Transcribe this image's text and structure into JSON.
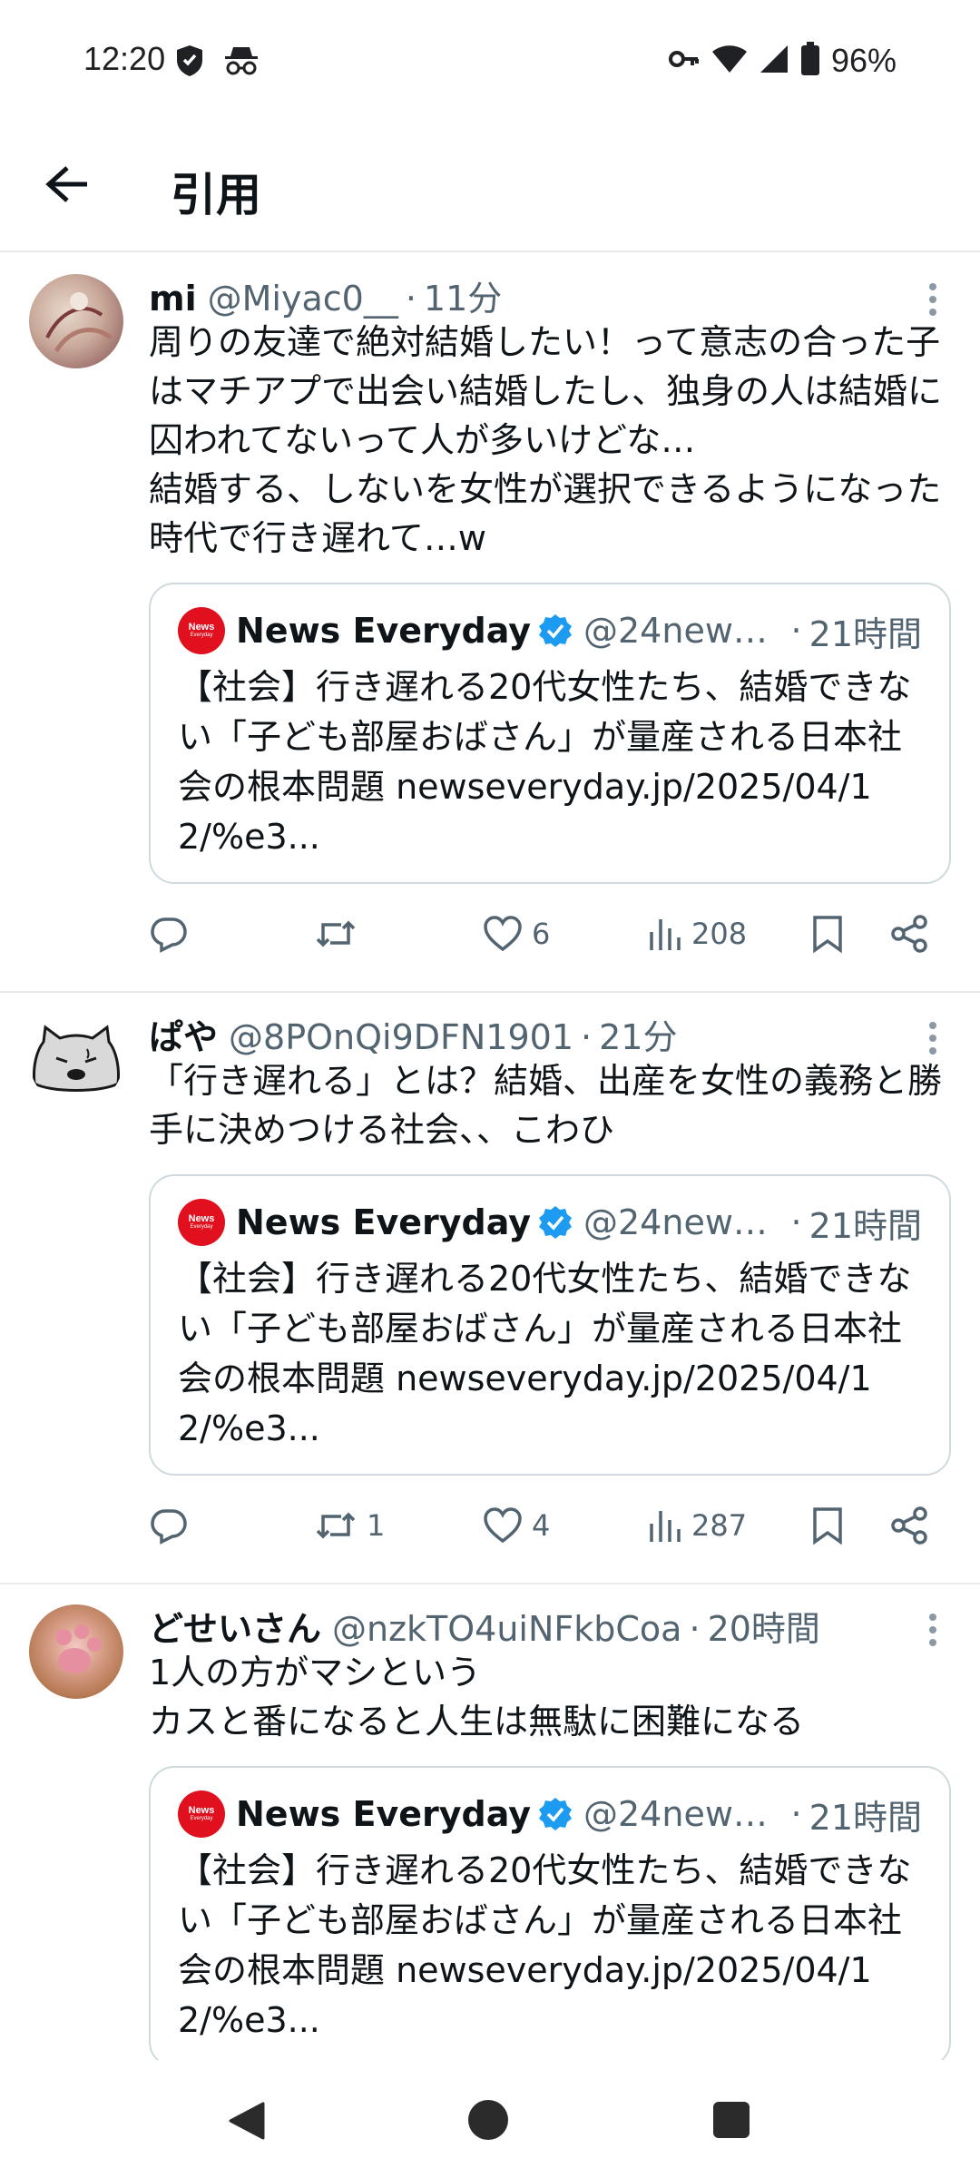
{
  "status_bar": {
    "time": "12:20",
    "battery": "96%",
    "left_icons": [
      "shield-icon",
      "incognito-icon"
    ],
    "right_icons": [
      "key-icon",
      "wifi-icon",
      "signal-icon",
      "battery-icon"
    ]
  },
  "header": {
    "title": "引用",
    "back_icon": "arrow-left-icon"
  },
  "tweets": [
    {
      "name": "mi",
      "handle": "@Miyac0__",
      "dot": "·",
      "time": "11分",
      "text": "周りの友達で絶対結婚したい！って意志の合った子はマチアプで出会い結婚したし、独身の人は結婚に囚われてないって人が多いけどな…\n結婚する、しないを女性が選択できるようになった時代で行き遅れて…w",
      "quote": {
        "name": "News Everyday",
        "handle": "@24news...",
        "dot": "·",
        "time": "21時間",
        "avatar_text": "News",
        "avatar_sub": "Everyday",
        "text": "【社会】行き遅れる20代女性たち、結婚できない「子ども部屋おばさん」が量産される日本社会の根本問題 newseveryday.jp/2025/04/12/%e3..."
      },
      "actions": {
        "reply": "",
        "retweet": "",
        "like": "6",
        "views": "208"
      }
    },
    {
      "name": "ぱや",
      "handle": "@8POnQi9DFN1901",
      "dot": "·",
      "time": "21分",
      "text": "「行き遅れる」とは？結婚、出産を女性の義務と勝手に決めつける社会、、こわひ",
      "quote": {
        "name": "News Everyday",
        "handle": "@24news...",
        "dot": "·",
        "time": "21時間",
        "avatar_text": "News",
        "avatar_sub": "Everyday",
        "text": "【社会】行き遅れる20代女性たち、結婚できない「子ども部屋おばさん」が量産される日本社会の根本問題 newseveryday.jp/2025/04/12/%e3..."
      },
      "actions": {
        "reply": "",
        "retweet": "1",
        "like": "4",
        "views": "287"
      }
    },
    {
      "name": "どせいさん",
      "handle": "@nzkTO4uiNFkbCoa",
      "dot": "·",
      "time": "20時間",
      "text": "1人の方がマシという\nカスと番になると人生は無駄に困難になる",
      "quote": {
        "name": "News Everyday",
        "handle": "@24news...",
        "dot": "·",
        "time": "21時間",
        "avatar_text": "News",
        "avatar_sub": "Everyday",
        "text": "【社会】行き遅れる20代女性たち、結婚できない「子ども部屋おばさん」が量産される日本社会の根本問題 newseveryday.jp/2025/04/12/%e3..."
      }
    }
  ],
  "colors": {
    "text": "#0f1419",
    "secondary": "#536471",
    "border": "#e7e9ea",
    "quote_border": "#cfd9de",
    "verified": "#1d9bf0",
    "news_red": "#e0101e"
  }
}
